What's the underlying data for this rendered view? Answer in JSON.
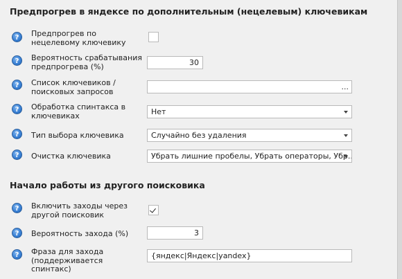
{
  "section1": {
    "title": "Предпрогрев в яндексе по дополнительным (нецелевым) ключевикам",
    "rows": [
      {
        "label": "Предпрогрев по нецелевому ключевику",
        "checked": false
      },
      {
        "label": "Вероятность срабатывания предпрогрева (%)",
        "value": "30"
      },
      {
        "label": "Список ключевиков / поисковых запросов",
        "value": "",
        "button": "..."
      },
      {
        "label": "Обработка спинтакса в ключевиках",
        "value": "Нет"
      },
      {
        "label": "Тип выбора ключевика",
        "value": "Случайно без удаления"
      },
      {
        "label": "Очистка ключевика",
        "value": "Убрать лишние пробелы, Убрать операторы, Убр..."
      }
    ]
  },
  "section2": {
    "title": "Начало работы из другого поисковика",
    "rows": [
      {
        "label": "Включить заходы через другой поисковик",
        "checked": true
      },
      {
        "label": "Вероятность захода (%)",
        "value": "3"
      },
      {
        "label": "Фраза для захода (поддерживается спинтакс)",
        "value": "{яндекс|Яндекс|yandex}"
      }
    ]
  },
  "help_icon": {
    "glyph": "?",
    "name": "help-icon",
    "color": "#3b82d6"
  }
}
